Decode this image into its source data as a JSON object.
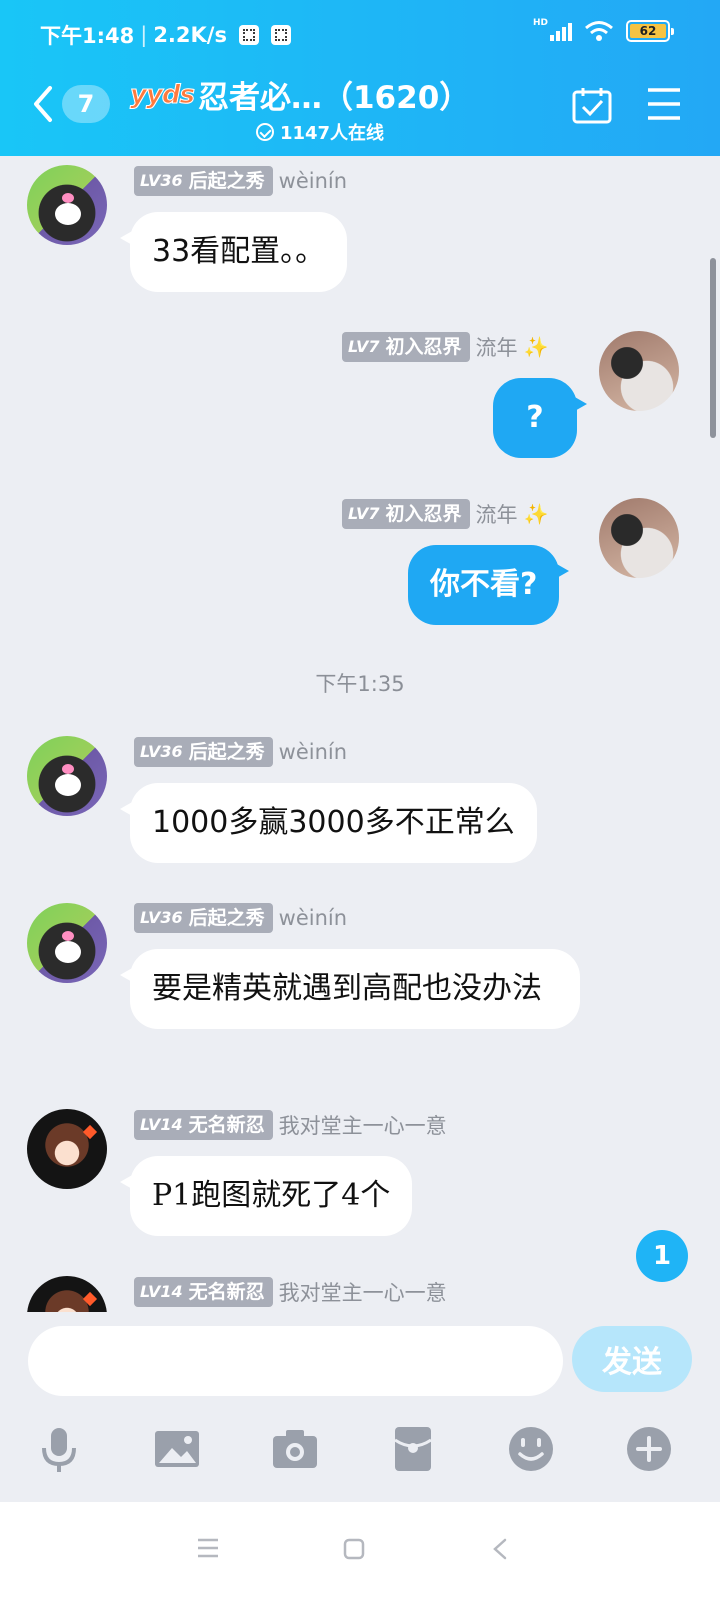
{
  "status_bar": {
    "time": "下午1:48",
    "speed": "2.2K/s",
    "network_label": "HD",
    "battery": "62"
  },
  "header": {
    "back_count": "7",
    "logo_text": "yyds",
    "title": "忍者必…（1620）",
    "online": "1147人在线"
  },
  "messages": [
    {
      "side": "left",
      "level": "LV36",
      "title": "后起之秀",
      "nick": "wèinín",
      "text": "33看配置。。"
    },
    {
      "side": "right",
      "level": "LV7",
      "title": "初入忍界",
      "nick": "流年",
      "text": "?"
    },
    {
      "side": "right",
      "level": "LV7",
      "title": "初入忍界",
      "nick": "流年",
      "text": "你不看?"
    },
    {
      "side": "left",
      "level": "LV36",
      "title": "后起之秀",
      "nick": "wèinín",
      "text": "1000多赢3000多不正常么"
    },
    {
      "side": "left",
      "level": "LV36",
      "title": "后起之秀",
      "nick": "wèinín",
      "text": "要是精英就遇到高配也没办法"
    },
    {
      "side": "left",
      "level": "LV14",
      "title": "无名新忍",
      "nick": "我对堂主一心一意",
      "text": "P1跑图就死了4个"
    },
    {
      "side": "left",
      "level": "LV14",
      "title": "无名新忍",
      "nick": "我对堂主一心一意",
      "text": ""
    }
  ],
  "timestamp": "下午1:35",
  "new_message_count": "1",
  "input": {
    "placeholder": "",
    "send_label": "发送"
  },
  "toolbar": [
    "microphone-icon",
    "image-icon",
    "camera-icon",
    "red-packet-icon",
    "emoji-icon",
    "plus-icon"
  ]
}
